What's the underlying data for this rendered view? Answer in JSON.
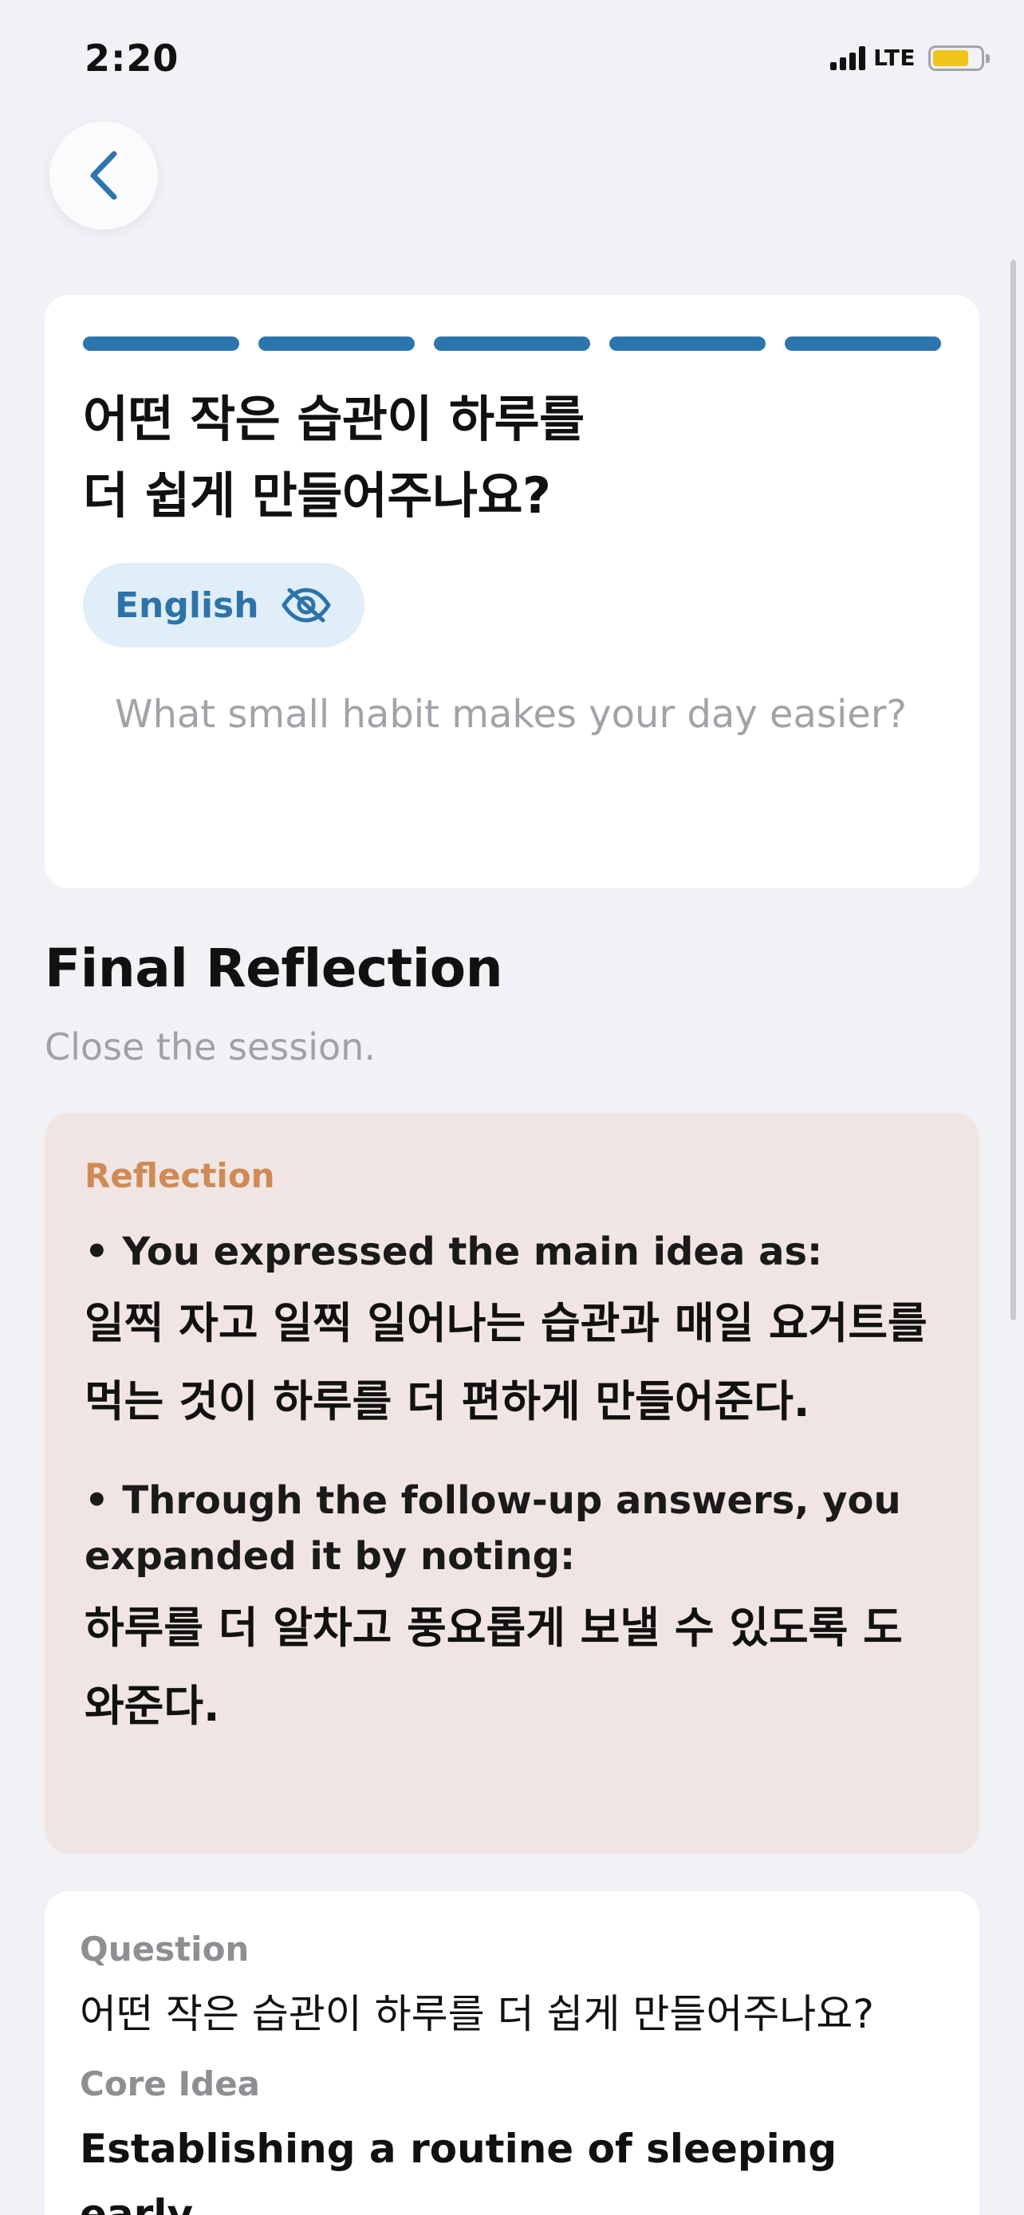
{
  "status_bar": {
    "time": "2:20",
    "network": "LTE"
  },
  "nav": {
    "back_icon": "chevron-left-icon"
  },
  "question_card": {
    "progress_segments": [
      true,
      true,
      true,
      true,
      true
    ],
    "question_ko_line1": "어떤 작은 습관이 하루를",
    "question_ko_line2": "더 쉽게 만들어주나요?",
    "language_chip_label": "English",
    "language_chip_icon": "eye-slash-icon",
    "question_en": "What small habit makes your day easier?"
  },
  "section": {
    "title": "Final Reflection",
    "subtitle": "Close the session."
  },
  "reflection": {
    "label": "Reflection",
    "bullet1": "• You expressed the main idea as:",
    "main_idea_ko": "일찍 자고 일찍 일어나는 습관과 매일 요거트를 먹는 것이 하루를 더 편하게 만들어준다.",
    "bullet2": "• Through the follow-up answers, you expanded it by noting:",
    "expansion_ko": "하루를 더 알차고 풍요롭게 보낼 수 있도록 도와준다."
  },
  "summary": {
    "question_label": "Question",
    "question_value": "어떤 작은 습관이 하루를 더 쉽게 만들어주나요?",
    "core_idea_label": "Core Idea",
    "core_idea_value_partial": "Establishing a routine of sleeping early"
  },
  "colors": {
    "background": "#f1f1f6",
    "accent_blue": "#2c76ad",
    "chip_bg": "#dfeef8",
    "reflection_bg": "#f0e5e2",
    "reflection_label": "#d08a56",
    "battery": "#f0c419"
  }
}
